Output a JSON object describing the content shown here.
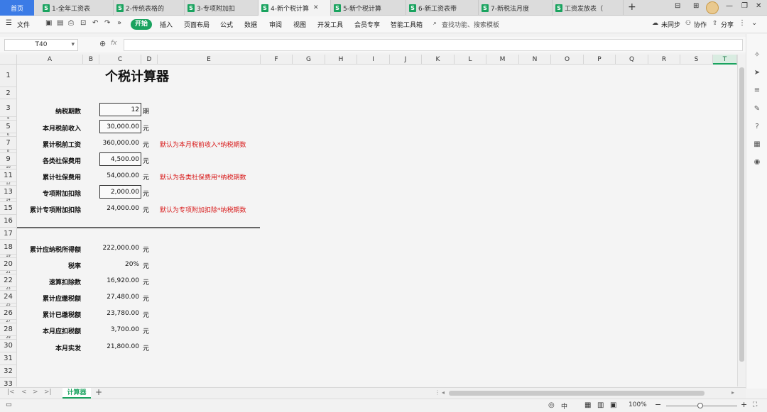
{
  "tabs": {
    "home": "首页",
    "docs": [
      {
        "label": "1-全年工资表"
      },
      {
        "label": "2-传统表格的"
      },
      {
        "label": "3-专项附加扣"
      },
      {
        "label": "4-新个税计算"
      },
      {
        "label": "5-新个税计算"
      },
      {
        "label": "6-新工资表带"
      },
      {
        "label": "7-新税法月度"
      },
      {
        "label": "工资发放表（"
      }
    ]
  },
  "toolbar": {
    "file": "文件",
    "start": "开始",
    "menus": [
      "插入",
      "页面布局",
      "公式",
      "数据",
      "审阅",
      "视图",
      "开发工具",
      "会员专享",
      "智能工具箱"
    ],
    "search_placeholder": "查找功能、搜索模板",
    "sync": "未同步",
    "collab": "协作",
    "share": "分享"
  },
  "formula": {
    "cell_ref": "T40",
    "fx": "fx"
  },
  "columns": [
    "A",
    "B",
    "C",
    "D",
    "E",
    "F",
    "G",
    "H",
    "I",
    "J",
    "K",
    "L",
    "M",
    "N",
    "O",
    "P",
    "Q",
    "R",
    "S",
    "T"
  ],
  "rows": [
    "1",
    "2",
    "3",
    "4",
    "5",
    "6",
    "7",
    "8",
    "9",
    "10",
    "11",
    "12",
    "13",
    "14",
    "15",
    "16",
    "17",
    "18",
    "19",
    "20",
    "21",
    "22",
    "23",
    "24",
    "25",
    "26",
    "27",
    "28",
    "29",
    "30",
    "31",
    "32",
    "33"
  ],
  "sheet": {
    "title": "个税计算器",
    "inputs": [
      {
        "label": "纳税期数",
        "value": "12",
        "unit": "期",
        "note": ""
      },
      {
        "label": "本月税前收入",
        "value": "30,000.00",
        "unit": "元",
        "note": ""
      },
      {
        "label": "累计税前工资",
        "value": "360,000.00",
        "unit": "元",
        "note": "默认为本月税前收入*纳税期数"
      },
      {
        "label": "各类社保费用",
        "value": "4,500.00",
        "unit": "元",
        "note": ""
      },
      {
        "label": "累计社保费用",
        "value": "54,000.00",
        "unit": "元",
        "note": "默认为各类社保费用*纳税期数"
      },
      {
        "label": "专项附加扣除",
        "value": "2,000.00",
        "unit": "元",
        "note": ""
      },
      {
        "label": "累计专项附加扣除",
        "value": "24,000.00",
        "unit": "元",
        "note": "默认为专项附加扣除*纳税期数"
      }
    ],
    "results": [
      {
        "label": "累计应纳税所得额",
        "value": "222,000.00",
        "unit": "元"
      },
      {
        "label": "税率",
        "value": "20%",
        "unit": "元"
      },
      {
        "label": "速算扣除数",
        "value": "16,920.00",
        "unit": "元"
      },
      {
        "label": "累计应缴税额",
        "value": "27,480.00",
        "unit": "元"
      },
      {
        "label": "累计已缴税额",
        "value": "23,780.00",
        "unit": "元"
      },
      {
        "label": "本月应扣税额",
        "value": "3,700.00",
        "unit": "元"
      },
      {
        "label": "本月实发",
        "value": "21,800.00",
        "unit": "元"
      }
    ]
  },
  "sheet_tab": "计算器",
  "status": {
    "zoom": "100%"
  }
}
